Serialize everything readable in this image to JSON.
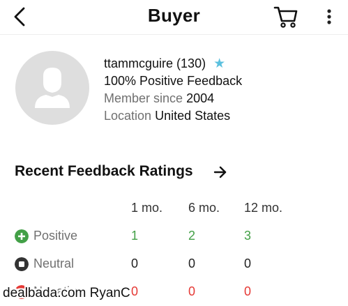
{
  "header": {
    "title": "Buyer",
    "icons": [
      "back-arrow",
      "cart",
      "more-vertical"
    ]
  },
  "profile": {
    "username": "ttammcguire",
    "score": "(130)",
    "star": "★",
    "feedback": "100% Positive Feedback",
    "member_since_label": "Member since",
    "member_since_value": "2004",
    "location_label": "Location",
    "location_value": "United States"
  },
  "ratings": {
    "title": "Recent Feedback Ratings",
    "columns": [
      "1 mo.",
      "6 mo.",
      "12 mo."
    ],
    "rows": [
      {
        "label": "Positive",
        "values": [
          "1",
          "2",
          "3"
        ],
        "color": "#43a047"
      },
      {
        "label": "Neutral",
        "values": [
          "0",
          "0",
          "0"
        ],
        "color": "#333333"
      },
      {
        "label": "Negative",
        "values": [
          "0",
          "0",
          "0"
        ],
        "color": "#e53935"
      }
    ]
  },
  "colors": {
    "star": "#5bc0de",
    "positive": "#43a047",
    "negative": "#e53935"
  },
  "watermark": "dealbada.com RyanC"
}
